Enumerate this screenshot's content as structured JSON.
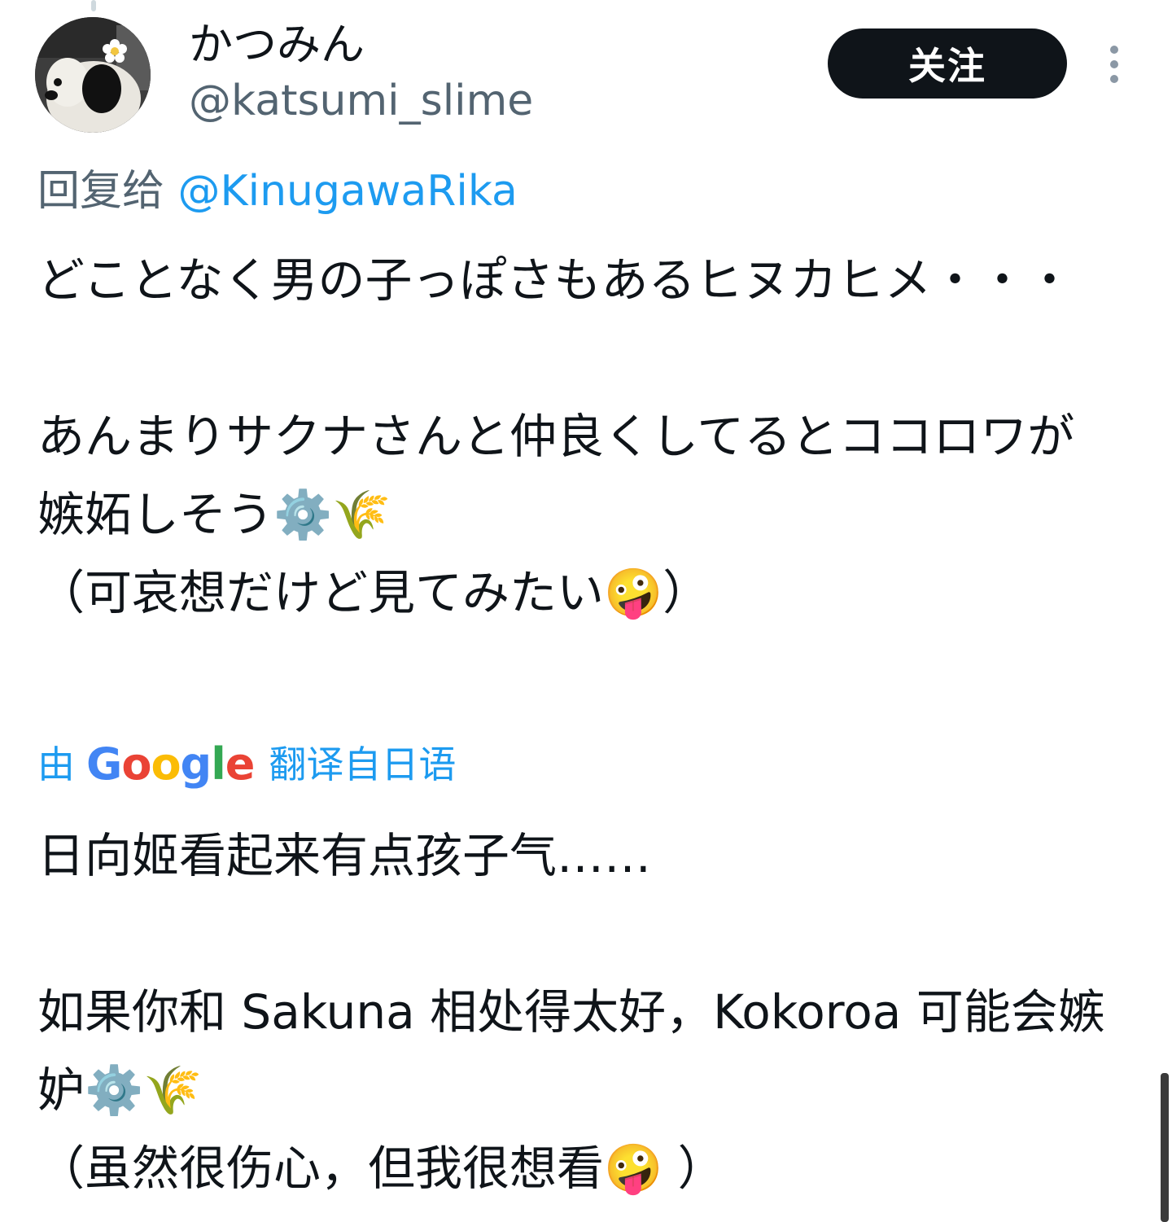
{
  "user": {
    "display_name": "かつみん",
    "handle": "@katsumi_slime"
  },
  "follow_label": "关注",
  "more_icon": "more-vertical-icon",
  "reply": {
    "label": "回复给",
    "mention": "@KinugawaRika"
  },
  "tweet": {
    "text": "どことなく男の子っぽさもあるヒヌカヒメ・・・\n\nあんまりサクナさんと仲良くしてるとココロワが嫉妬しそう⚙️🌾\n（可哀想だけど見てみたい🤪）"
  },
  "translation": {
    "prefix": "由",
    "provider_letters": [
      "G",
      "o",
      "o",
      "g",
      "l",
      "e"
    ],
    "suffix": "翻译自日语",
    "text": "日向姬看起来有点孩子气……\n\n如果你和 Sakuna 相处得太好，Kokoroa 可能会嫉妒⚙️🌾\n（虽然很伤心，但我很想看🤪 ）"
  },
  "colors": {
    "link_blue": "#1d9bf0",
    "secondary_gray": "#536471",
    "button_dark": "#0f1419",
    "google_blue": "#4285f4",
    "google_red": "#ea4335",
    "google_yellow": "#fbbc05",
    "google_green": "#34a853"
  }
}
